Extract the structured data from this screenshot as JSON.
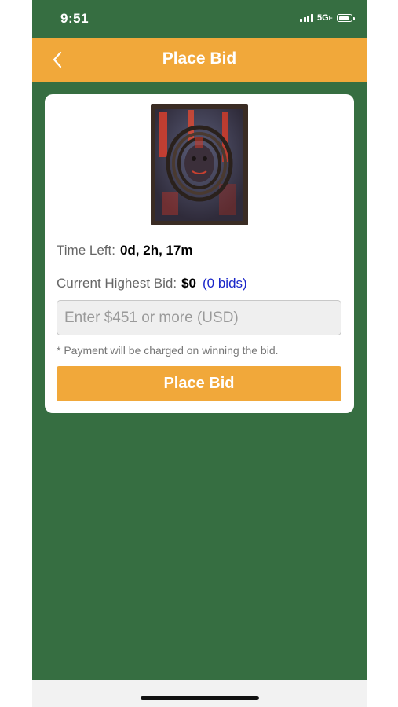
{
  "status_bar": {
    "time": "9:51",
    "network": "5G",
    "network_suffix": "E"
  },
  "nav": {
    "back_icon": "chevron-left-icon",
    "title": "Place Bid"
  },
  "auction": {
    "artwork_icon": "artwork-thumbnail",
    "time_left_label": "Time Left:",
    "time_left_value": "0d, 2h, 17m",
    "current_bid_label": "Current Highest Bid:",
    "current_bid_value": "$0",
    "bid_count": "(0 bids)",
    "bid_input_placeholder": "Enter $451 or more (USD)",
    "bid_input_value": "",
    "payment_note": "* Payment will be charged on winning the bid.",
    "place_bid_label": "Place Bid"
  },
  "colors": {
    "background_green": "#366e41",
    "accent_orange": "#f1a83a",
    "link_blue": "#1a26c9"
  }
}
